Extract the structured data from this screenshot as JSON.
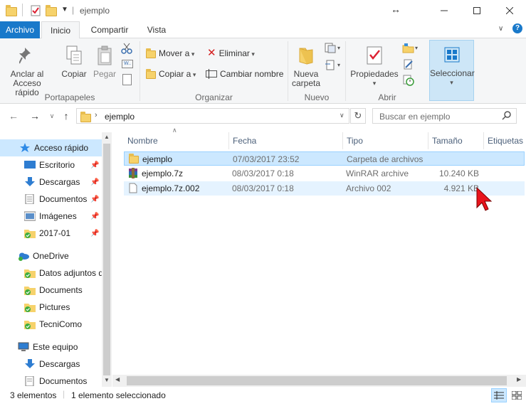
{
  "window": {
    "title": "ejemplo",
    "qa_separator": "|"
  },
  "tabs": [
    {
      "label": "Archivo"
    },
    {
      "label": "Inicio"
    },
    {
      "label": "Compartir"
    },
    {
      "label": "Vista"
    }
  ],
  "ribbon": {
    "portapapeles": {
      "label": "Portapapeles",
      "anclar": "Anclar al Acceso rápido",
      "copiar": "Copiar",
      "pegar": "Pegar"
    },
    "organizar": {
      "label": "Organizar",
      "mover_a": "Mover a",
      "copiar_a": "Copiar a",
      "eliminar": "Eliminar",
      "cambiar_nombre": "Cambiar nombre"
    },
    "nuevo": {
      "label": "Nuevo",
      "nueva_carpeta": "Nueva carpeta"
    },
    "abrir": {
      "label": "Abrir",
      "propiedades": "Propiedades"
    },
    "seleccionar": {
      "label": "Seleccionar"
    }
  },
  "address": {
    "crumb": "ejemplo",
    "search_placeholder": "Buscar en ejemplo"
  },
  "nav": {
    "items": [
      {
        "label": "Acceso rápido"
      },
      {
        "label": "Escritorio"
      },
      {
        "label": "Descargas"
      },
      {
        "label": "Documentos"
      },
      {
        "label": "Imágenes"
      },
      {
        "label": "2017-01"
      },
      {
        "label": "OneDrive"
      },
      {
        "label": "Datos adjuntos de correo"
      },
      {
        "label": "Documents"
      },
      {
        "label": "Pictures"
      },
      {
        "label": "TecniComo"
      },
      {
        "label": "Este equipo"
      },
      {
        "label": "Descargas"
      },
      {
        "label": "Documentos"
      }
    ]
  },
  "columns": [
    {
      "label": "Nombre"
    },
    {
      "label": "Fecha"
    },
    {
      "label": "Tipo"
    },
    {
      "label": "Tamaño"
    },
    {
      "label": "Etiquetas"
    }
  ],
  "files": [
    {
      "name": "ejemplo",
      "date": "07/03/2017 23:52",
      "type": "Carpeta de archivos",
      "size": "",
      "icon": "folder-icon"
    },
    {
      "name": "ejemplo.7z",
      "date": "08/03/2017 0:18",
      "type": "WinRAR archive",
      "size": "10.240 KB",
      "icon": "winrar-icon"
    },
    {
      "name": "ejemplo.7z.002",
      "date": "08/03/2017 0:18",
      "type": "Archivo 002",
      "size": "4.921 KB",
      "icon": "file-icon"
    }
  ],
  "status": {
    "count": "3 elementos",
    "selected": "1 elemento seleccionado"
  },
  "colors": {
    "accent": "#1979ca",
    "selection": "#cce8ff"
  }
}
